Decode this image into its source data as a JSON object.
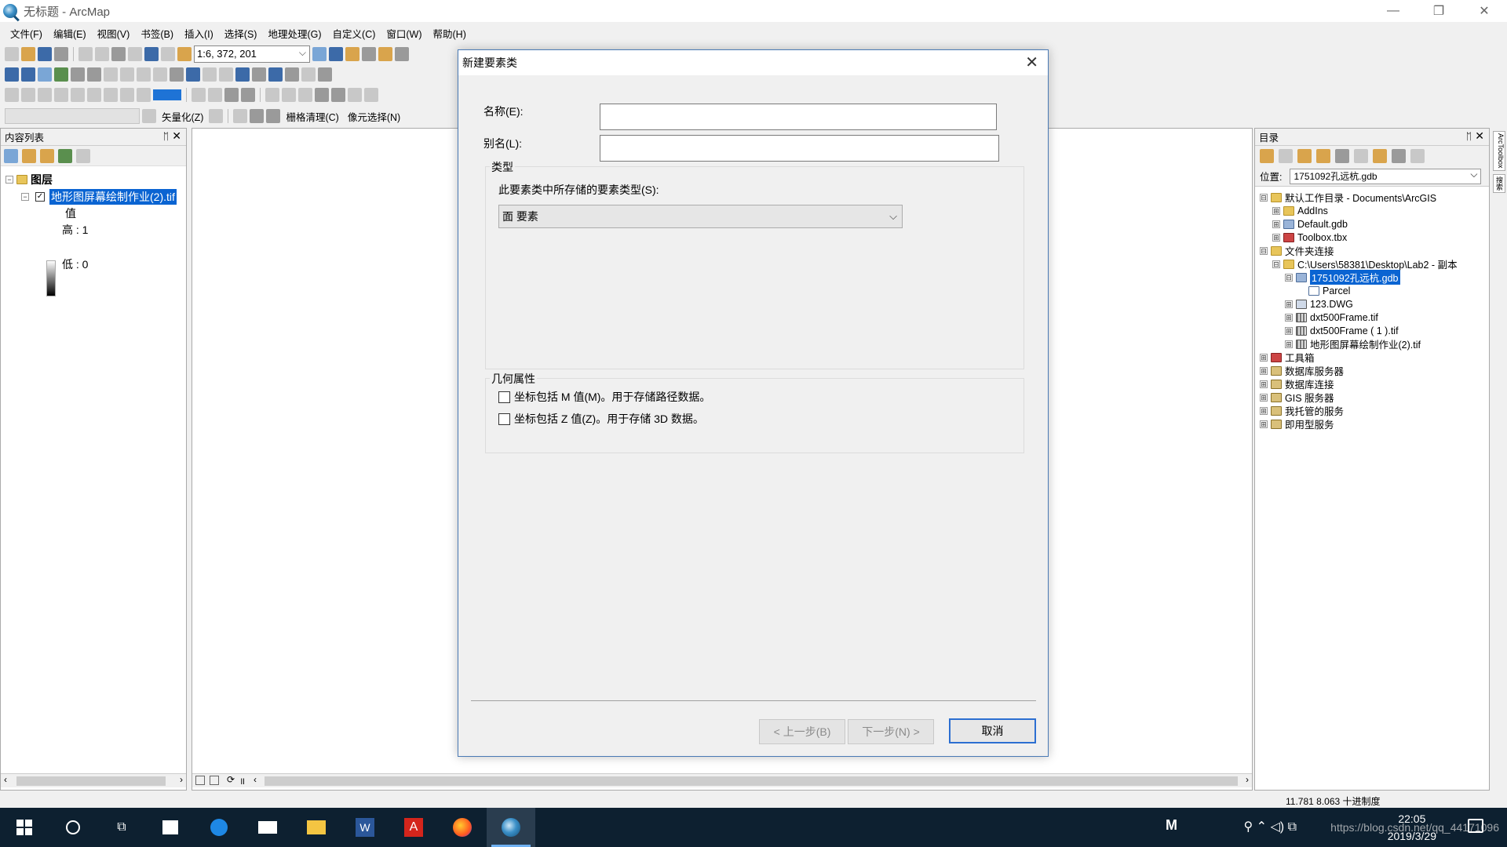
{
  "window": {
    "title": "无标题 - ArcMap",
    "minimize": "—",
    "maximize": "❐",
    "close": "✕"
  },
  "menu": [
    "文件(F)",
    "编辑(E)",
    "视图(V)",
    "书签(B)",
    "插入(I)",
    "选择(S)",
    "地理处理(G)",
    "自定义(C)",
    "窗口(W)",
    "帮助(H)"
  ],
  "toolbar": {
    "scale": "1:6, 372, 201",
    "vectorize": "矢量化(Z)",
    "raster_cleanup": "栅格清理(C)",
    "cell_select": "像元选择(N)"
  },
  "toc": {
    "title": "内容列表",
    "layers_label": "图层",
    "layer_name": "地形图屏幕绘制作业(2).tif",
    "value_label": "值",
    "high_label": "高 : 1",
    "low_label": "低 : 0"
  },
  "catalog": {
    "title": "目录",
    "location_label": "位置:",
    "location_value": "1751092孔远杭.gdb",
    "tree": [
      {
        "label": "默认工作目录 - Documents\\ArcGIS",
        "expander": "⊟",
        "icon": "folder-icon"
      },
      {
        "label": "AddIns",
        "expander": "⊞",
        "icon": "folder-icon"
      },
      {
        "label": "Default.gdb",
        "expander": "⊞",
        "icon": "geodatabase-icon"
      },
      {
        "label": "Toolbox.tbx",
        "expander": "⊞",
        "icon": "toolbox-icon"
      },
      {
        "label": "文件夹连接",
        "expander": "⊟",
        "icon": "folder-connection-icon"
      },
      {
        "label": "C:\\Users\\58381\\Desktop\\Lab2 - 副本",
        "expander": "⊟",
        "icon": "folder-icon"
      },
      {
        "label": "1751092孔远杭.gdb",
        "expander": "⊟",
        "icon": "geodatabase-icon",
        "selected": true
      },
      {
        "label": "Parcel",
        "expander": "",
        "icon": "feature-class-icon"
      },
      {
        "label": "123.DWG",
        "expander": "⊞",
        "icon": "cad-icon"
      },
      {
        "label": "dxt500Frame.tif",
        "expander": "⊞",
        "icon": "raster-icon"
      },
      {
        "label": "dxt500Frame ( 1 ).tif",
        "expander": "⊞",
        "icon": "raster-icon"
      },
      {
        "label": "地形图屏幕绘制作业(2).tif",
        "expander": "⊞",
        "icon": "raster-icon"
      },
      {
        "label": "工具箱",
        "expander": "⊞",
        "icon": "toolbox-icon"
      },
      {
        "label": "数据库服务器",
        "expander": "⊞",
        "icon": "server-icon"
      },
      {
        "label": "数据库连接",
        "expander": "⊞",
        "icon": "server-icon"
      },
      {
        "label": "GIS 服务器",
        "expander": "⊞",
        "icon": "server-icon"
      },
      {
        "label": "我托管的服务",
        "expander": "⊞",
        "icon": "server-icon"
      },
      {
        "label": "即用型服务",
        "expander": "⊞",
        "icon": "server-icon"
      }
    ]
  },
  "sidetabs": [
    "ArcToolbox",
    "搜索"
  ],
  "status": {
    "coords": "11.781  8.063 十进制度"
  },
  "dialog": {
    "title": "新建要素类",
    "name_label": "名称(E):",
    "name_value": "",
    "alias_label": "别名(L):",
    "alias_value": "",
    "type_group": "类型",
    "type_prompt": "此要素类中所存储的要素类型(S):",
    "type_value": "面 要素",
    "geometry_group": "几何属性",
    "m_values": "坐标包括 M 值(M)。用于存储路径数据。",
    "z_values": "坐标包括 Z 值(Z)。用于存储 3D 数据。",
    "back_button": "< 上一步(B)",
    "next_button": "下一步(N) >",
    "cancel_button": "取消"
  },
  "taskbar": {
    "clock_time": "22:05",
    "clock_date": "2019/3/29",
    "ime": "M",
    "watermark": "https://blog.csdn.net/qq_44171096"
  },
  "colors": {
    "selection": "#0a64d2",
    "dialog_border": "#4a7ab5",
    "taskbar": "#0d2030"
  }
}
